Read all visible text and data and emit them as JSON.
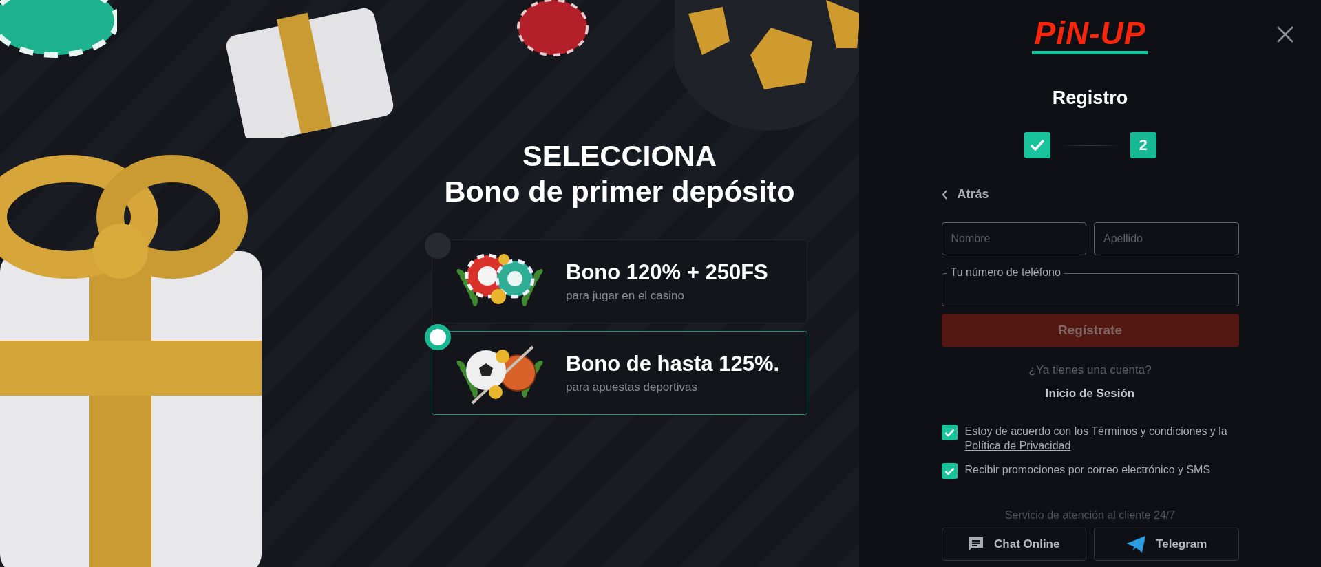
{
  "promo": {
    "title": "SELECCIONA",
    "subtitle": "Bono de primer depósito",
    "bonuses": [
      {
        "kind": "casino",
        "title": "Bono 120% + 250FS",
        "subtitle": "para jugar en el casino",
        "selected": false
      },
      {
        "kind": "sports",
        "title": "Bono de hasta 125%.",
        "subtitle": "para apuestas deportivas",
        "selected": true
      }
    ]
  },
  "registration": {
    "logo": "PiN-UP",
    "title": "Registro",
    "steps": [
      {
        "completed": true
      },
      {
        "completed": false,
        "label": "2"
      }
    ],
    "back_link": "Atrás",
    "name_fields": [
      {
        "placeholder": "Nombre"
      },
      {
        "placeholder": "Apellido"
      }
    ],
    "phone_field": {
      "label": "Tu número de teléfono"
    },
    "submit": {
      "label": "Regístrate",
      "disabled": true
    },
    "has_account": "¿Ya tienes una cuenta?",
    "login_link": "Inicio de Sesión",
    "consents": [
      {
        "checked": true,
        "parts": [
          {
            "kind": "text",
            "text": "Estoy de acuerdo con los "
          },
          {
            "kind": "link",
            "text": "Términos y condiciones"
          },
          {
            "kind": "text",
            "text": " y la "
          },
          {
            "kind": "link",
            "text": "Política de Privacidad"
          }
        ]
      },
      {
        "checked": true,
        "parts": [
          {
            "kind": "text",
            "text": "Recibir promociones por correo electrónico y SMS"
          }
        ]
      }
    ],
    "support": {
      "title": "Servicio de atención al cliente 24/7",
      "buttons": [
        {
          "kind": "chat",
          "label": "Chat Online"
        },
        {
          "kind": "telegram",
          "label": "Telegram"
        }
      ]
    }
  }
}
